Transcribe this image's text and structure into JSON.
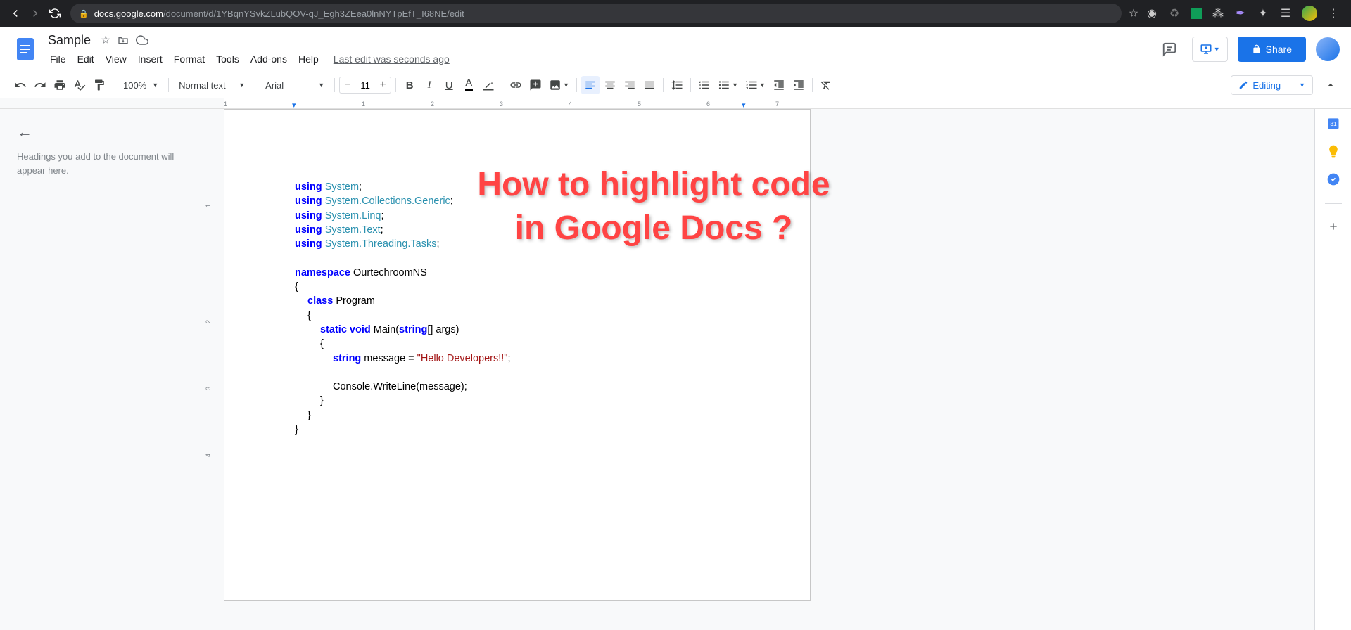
{
  "browser": {
    "host": "docs.google.com",
    "path": "/document/d/1YBqnYSvkZLubQOV-qJ_Egh3ZEea0lnNYTpEfT_I68NE/edit"
  },
  "document": {
    "title": "Sample",
    "last_edit": "Last edit was seconds ago"
  },
  "menus": [
    "File",
    "Edit",
    "View",
    "Insert",
    "Format",
    "Tools",
    "Add-ons",
    "Help"
  ],
  "toolbar": {
    "zoom": "100%",
    "style": "Normal text",
    "font": "Arial",
    "fontsize": "11",
    "editing": "Editing"
  },
  "share_label": "Share",
  "outline": {
    "placeholder": "Headings you add to the document will appear here."
  },
  "ruler": [
    "1",
    "1",
    "2",
    "3",
    "4",
    "5",
    "6",
    "7"
  ],
  "vruler": [
    "1",
    "2",
    "3",
    "4"
  ],
  "code": {
    "usings": [
      "System",
      "System.Collections.Generic",
      "System.Linq",
      "System.Text",
      "System.Threading.Tasks"
    ],
    "namespace": "OurtechroomNS",
    "class": "Program",
    "method_sig": "Main",
    "arg_type": "string",
    "arg_rest": "[] args)",
    "var_type": "string",
    "var_rest": " message = ",
    "string_literal": "\"Hello Developers!!\"",
    "console_call_pre": "Console.",
    "console_call_method": "WriteLine",
    "console_call_post": "(message);"
  },
  "annotation": {
    "line1": "How to highlight code",
    "line2": "in Google Docs ?"
  }
}
